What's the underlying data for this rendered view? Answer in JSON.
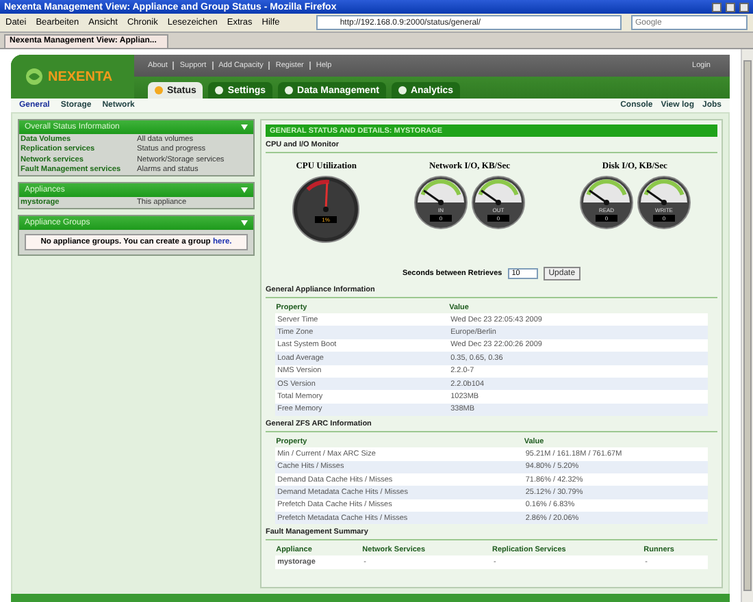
{
  "browser": {
    "title": "Nexenta Management View: Appliance and Group Status - Mozilla Firefox",
    "menu": [
      "Datei",
      "Bearbeiten",
      "Ansicht",
      "Chronik",
      "Lesezeichen",
      "Extras",
      "Hilfe"
    ],
    "url": "http://192.168.0.9:2000/status/general/",
    "search": {
      "placeholder": "Google"
    },
    "tab": "Nexenta Management View: Applian..."
  },
  "header": {
    "logo": "NEXENTA",
    "links": [
      "About",
      "Support",
      "Add Capacity",
      "Register",
      "Help"
    ],
    "login": "Login"
  },
  "tabs": [
    {
      "label": "Status",
      "selected": true
    },
    {
      "label": "Settings",
      "selected": false
    },
    {
      "label": "Data Management",
      "selected": false
    },
    {
      "label": "Analytics",
      "selected": false
    }
  ],
  "subnav": [
    {
      "label": "General",
      "selected": true
    },
    {
      "label": "Storage",
      "selected": false
    },
    {
      "label": "Network",
      "selected": false
    }
  ],
  "tools": [
    "Console",
    "View log",
    "Jobs"
  ],
  "sidebar": [
    {
      "title": "Overall Status Information",
      "rows": [
        {
          "link": "Data Volumes",
          "description": "All data volumes"
        },
        {
          "link": "Replication services",
          "description": "Status and progress"
        },
        {
          "link": "Network services",
          "description": "Network/Storage services"
        },
        {
          "link": "Fault Management services",
          "description": "Alarms and status"
        }
      ]
    },
    {
      "title": "Appliances",
      "rows": [
        {
          "link": "mystorage",
          "description": "This appliance"
        }
      ]
    },
    {
      "title": "Appliance Groups",
      "message": "No appliance groups. You can create a group ",
      "message_link": "here."
    }
  ],
  "main": {
    "title": "GENERAL STATUS AND DETAILS: MYSTORAGE",
    "monitor_title": "CPU and I/O Monitor",
    "gauge_groups": [
      {
        "title": "CPU Utilization",
        "gauges": [
          {
            "kind": "dark",
            "reading": "1%"
          }
        ]
      },
      {
        "title": "Network I/O, KB/Sec",
        "gauges": [
          {
            "kind": "light",
            "label": "IN",
            "reading": "0"
          },
          {
            "kind": "light",
            "label": "OUT",
            "reading": "0"
          }
        ]
      },
      {
        "title": "Disk I/O, KB/Sec",
        "gauges": [
          {
            "kind": "light",
            "label": "READ",
            "reading": "0"
          },
          {
            "kind": "light",
            "label": "WRITE",
            "reading": "0"
          }
        ]
      }
    ],
    "retrieve": {
      "label": "Seconds between Retrieves",
      "value": "10",
      "button": "Update"
    },
    "tables": [
      {
        "title": "General Appliance Information",
        "columns": [
          "Property",
          "Value"
        ],
        "rows": [
          [
            "Server Time",
            "Wed Dec 23 22:05:43 2009"
          ],
          [
            "Time Zone",
            "Europe/Berlin"
          ],
          [
            "Last System Boot",
            "Wed Dec 23 22:00:26 2009"
          ],
          [
            "Load Average",
            "0.35, 0.65, 0.36"
          ],
          [
            "NMS Version",
            "2.2.0-7"
          ],
          [
            "OS Version",
            "2.2.0b104"
          ],
          [
            "Total Memory",
            "1023MB"
          ],
          [
            "Free Memory",
            "338MB"
          ]
        ]
      },
      {
        "title": "General ZFS ARC Information",
        "columns": [
          "Property",
          "Value"
        ],
        "rows": [
          [
            "Min / Current / Max ARC Size",
            "95.21M / 161.18M / 761.67M"
          ],
          [
            "Cache Hits / Misses",
            "94.80% / 5.20%"
          ],
          [
            "Demand Data Cache Hits / Misses",
            "71.86% / 42.32%"
          ],
          [
            "Demand Metadata Cache Hits / Misses",
            "25.12% / 30.79%"
          ],
          [
            "Prefetch Data Cache Hits / Misses",
            "0.16% / 6.83%"
          ],
          [
            "Prefetch Metadata Cache Hits / Misses",
            "2.86% / 20.06%"
          ]
        ]
      },
      {
        "title": "Fault Management Summary",
        "columns": [
          "Appliance",
          "Network Services",
          "Replication Services",
          "Runners"
        ],
        "rows": [
          [
            "mystorage",
            "-",
            "-",
            "-"
          ]
        ]
      }
    ]
  }
}
